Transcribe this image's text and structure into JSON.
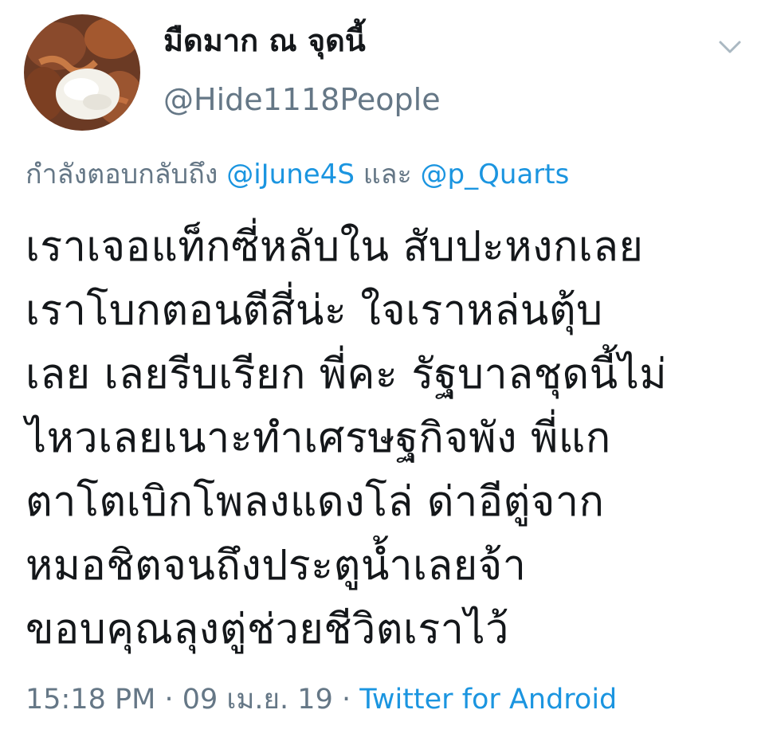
{
  "tweet": {
    "display_name": "มืดมาก ณ จุดนี้",
    "handle": "@Hide1118People",
    "menu_icon": "chevron-down-icon",
    "reply": {
      "prefix": "กำลังตอบกลับถึง",
      "mention_1": "@iJune4S",
      "conjunction": "และ",
      "mention_2": "@p_Quarts"
    },
    "text_lines": [
      "เราเจอแท็กซี่หลับใน สับปะหงกเลย",
      "เราโบกตอนตีสี่น่ะ  ใจเราหล่นตุ้บ",
      "เลย เลยรีบเรียก พี่คะ รัฐบาลชุดนี้ไม่",
      "ไหวเลยเนาะทำเศรษฐกิจพัง พี่แก",
      "ตาโตเบิกโพลงแดงโล่ ด่าอีตู่จาก",
      "หมอชิตจนถึงประตูน้ำเลยจ้า",
      "ขอบคุณลุงตู่ช่วยชีวิตเราไว้"
    ],
    "time": "15:18 PM",
    "separator": "·",
    "date": "09 เม.ย. 19",
    "source": "Twitter for Android"
  },
  "colors": {
    "text": "#14171a",
    "secondary": "#657786",
    "link": "#1b95e0"
  }
}
